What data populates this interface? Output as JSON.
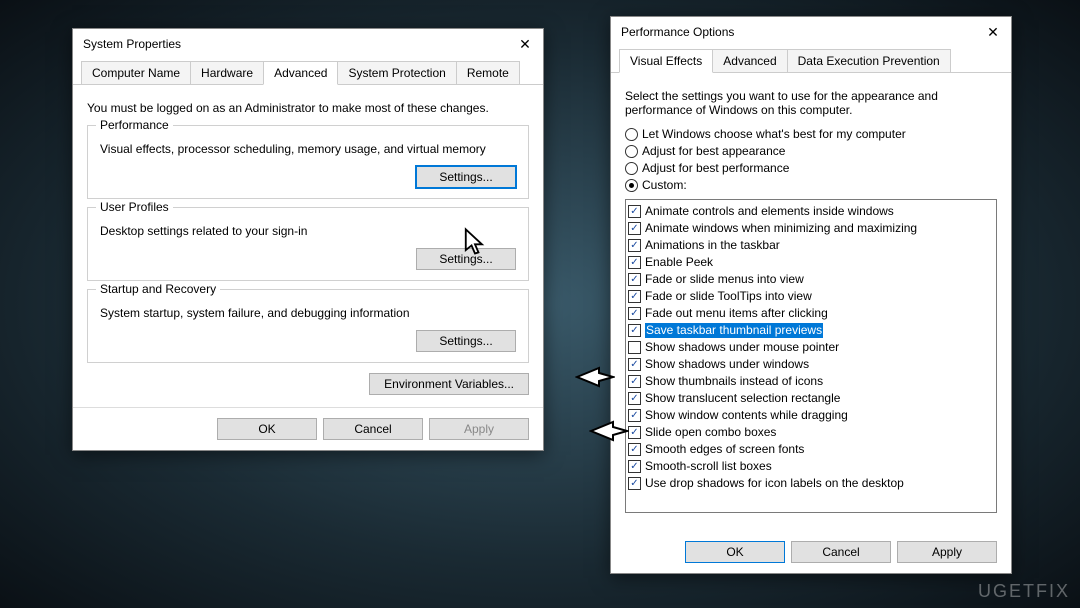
{
  "sysprops": {
    "title": "System Properties",
    "tabs": [
      "Computer Name",
      "Hardware",
      "Advanced",
      "System Protection",
      "Remote"
    ],
    "active_tab": 2,
    "intro": "You must be logged on as an Administrator to make most of these changes.",
    "groups": {
      "performance": {
        "legend": "Performance",
        "desc": "Visual effects, processor scheduling, memory usage, and virtual memory",
        "button": "Settings..."
      },
      "profiles": {
        "legend": "User Profiles",
        "desc": "Desktop settings related to your sign-in",
        "button": "Settings..."
      },
      "startup": {
        "legend": "Startup and Recovery",
        "desc": "System startup, system failure, and debugging information",
        "button": "Settings..."
      }
    },
    "envvars": "Environment Variables...",
    "buttons": {
      "ok": "OK",
      "cancel": "Cancel",
      "apply": "Apply"
    }
  },
  "perfopts": {
    "title": "Performance Options",
    "tabs": [
      "Visual Effects",
      "Advanced",
      "Data Execution Prevention"
    ],
    "active_tab": 0,
    "intro": "Select the settings you want to use for the appearance and performance of Windows on this computer.",
    "radios": [
      {
        "label": "Let Windows choose what's best for my computer",
        "checked": false
      },
      {
        "label": "Adjust for best appearance",
        "checked": false
      },
      {
        "label": "Adjust for best performance",
        "checked": false
      },
      {
        "label": "Custom:",
        "checked": true
      }
    ],
    "checks": [
      {
        "label": "Animate controls and elements inside windows",
        "checked": true,
        "selected": false
      },
      {
        "label": "Animate windows when minimizing and maximizing",
        "checked": true,
        "selected": false
      },
      {
        "label": "Animations in the taskbar",
        "checked": true,
        "selected": false
      },
      {
        "label": "Enable Peek",
        "checked": true,
        "selected": false
      },
      {
        "label": "Fade or slide menus into view",
        "checked": true,
        "selected": false
      },
      {
        "label": "Fade or slide ToolTips into view",
        "checked": true,
        "selected": false
      },
      {
        "label": "Fade out menu items after clicking",
        "checked": true,
        "selected": false
      },
      {
        "label": "Save taskbar thumbnail previews",
        "checked": true,
        "selected": true
      },
      {
        "label": "Show shadows under mouse pointer",
        "checked": false,
        "selected": false
      },
      {
        "label": "Show shadows under windows",
        "checked": true,
        "selected": false
      },
      {
        "label": "Show thumbnails instead of icons",
        "checked": true,
        "selected": false
      },
      {
        "label": "Show translucent selection rectangle",
        "checked": true,
        "selected": false
      },
      {
        "label": "Show window contents while dragging",
        "checked": true,
        "selected": false
      },
      {
        "label": "Slide open combo boxes",
        "checked": true,
        "selected": false
      },
      {
        "label": "Smooth edges of screen fonts",
        "checked": true,
        "selected": false
      },
      {
        "label": "Smooth-scroll list boxes",
        "checked": true,
        "selected": false
      },
      {
        "label": "Use drop shadows for icon labels on the desktop",
        "checked": true,
        "selected": false
      }
    ],
    "buttons": {
      "ok": "OK",
      "cancel": "Cancel",
      "apply": "Apply"
    }
  },
  "watermark": "UGETFIX"
}
